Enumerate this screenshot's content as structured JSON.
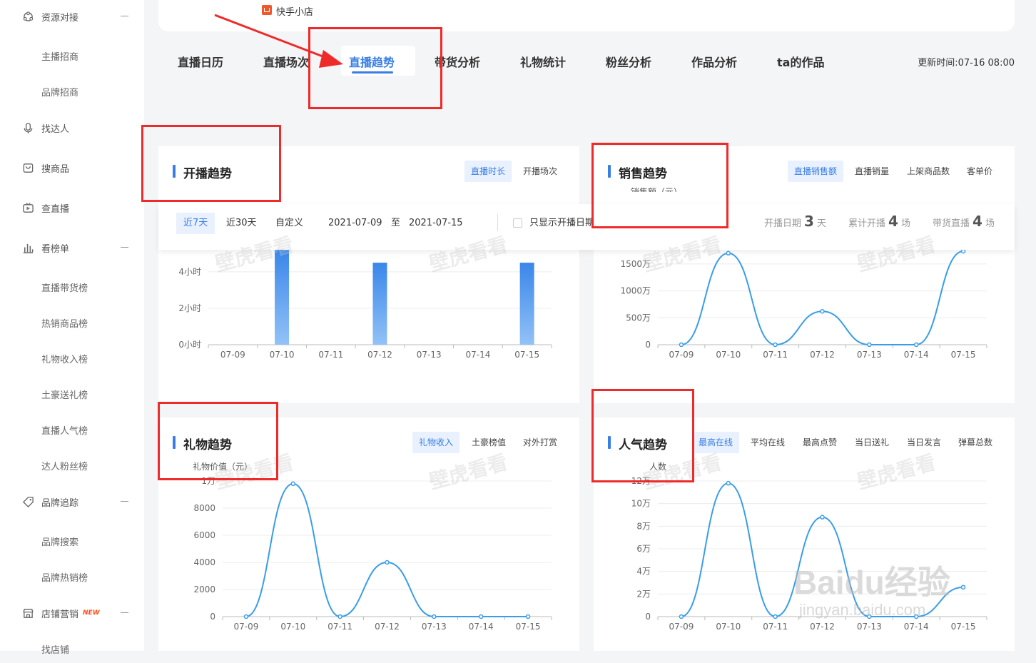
{
  "sidebar": {
    "items": [
      {
        "type": "parent",
        "label": "资源对接",
        "icon": "resource-icon",
        "collapse": true
      },
      {
        "type": "child",
        "label": "主播招商"
      },
      {
        "type": "child",
        "label": "品牌招商"
      },
      {
        "type": "parent",
        "label": "找达人",
        "icon": "microphone-icon"
      },
      {
        "type": "parent",
        "label": "搜商品",
        "icon": "shopping-bag-icon"
      },
      {
        "type": "parent",
        "label": "查直播",
        "icon": "tv-icon"
      },
      {
        "type": "parent",
        "label": "看榜单",
        "icon": "bar-chart-icon",
        "collapse": true
      },
      {
        "type": "child",
        "label": "直播带货榜"
      },
      {
        "type": "child",
        "label": "热销商品榜"
      },
      {
        "type": "child",
        "label": "礼物收入榜"
      },
      {
        "type": "child",
        "label": "土豪送礼榜"
      },
      {
        "type": "child",
        "label": "直播人气榜"
      },
      {
        "type": "child",
        "label": "达人粉丝榜"
      },
      {
        "type": "parent",
        "label": "品牌追踪",
        "icon": "tag-icon",
        "collapse": true
      },
      {
        "type": "child",
        "label": "品牌搜索"
      },
      {
        "type": "child",
        "label": "品牌热销榜"
      },
      {
        "type": "parent",
        "label": "店铺营销",
        "icon": "store-icon",
        "collapse": true,
        "badge": "NEW"
      },
      {
        "type": "child",
        "label": "找店铺"
      }
    ]
  },
  "top": {
    "shop_name": "快手小店"
  },
  "tabs": [
    "直播日历",
    "直播场次",
    "直播趋势",
    "带货分析",
    "礼物统计",
    "粉丝分析",
    "作品分析",
    "ta的作品"
  ],
  "active_tab": "直播趋势",
  "update_time": "更新时间:07-16 08:00",
  "filter": {
    "ranges": [
      "近7天",
      "近30天",
      "自定义"
    ],
    "active_range": "近7天",
    "date_start": "2021-07-09",
    "date_sep": "至",
    "date_end": "2021-07-15",
    "checkbox_label": "只显示开播日期",
    "stats": [
      {
        "label": "开播日期",
        "value": "3",
        "unit": "天"
      },
      {
        "label": "累计开播",
        "value": "4",
        "unit": "场"
      },
      {
        "label": "带货直播",
        "value": "4",
        "unit": "场"
      }
    ]
  },
  "panels": {
    "broadcast": {
      "title": "开播趋势",
      "buttons": [
        "直播时长",
        "开播场次"
      ],
      "active": "直播时长"
    },
    "sales": {
      "title": "销售趋势",
      "buttons": [
        "直播销售额",
        "直播销量",
        "上架商品数",
        "客单价"
      ],
      "active": "直播销售额",
      "unit_partial": "销售额（元）"
    },
    "gift": {
      "title": "礼物趋势",
      "buttons": [
        "礼物收入",
        "土豪榜值",
        "对外打赏"
      ],
      "active": "礼物收入",
      "unit": "礼物价值（元）"
    },
    "popularity": {
      "title": "人气趋势",
      "buttons": [
        "最高在线",
        "平均在线",
        "最高点赞",
        "当日送礼",
        "当日发言",
        "弹幕总数"
      ],
      "active": "最高在线",
      "unit": "人数"
    }
  },
  "chart_data": [
    {
      "type": "bar",
      "name_ref": "开播趋势",
      "categories": [
        "07-09",
        "07-10",
        "07-11",
        "07-12",
        "07-13",
        "07-14",
        "07-15"
      ],
      "values": [
        0,
        6.5,
        0,
        4.5,
        0,
        0,
        4.5
      ],
      "ytick_labels": [
        "0小时",
        "2小时",
        "4小时"
      ],
      "yticks": [
        0,
        2,
        4
      ],
      "ylim": [
        0,
        5.6
      ],
      "ylabel": "",
      "xlabel": ""
    },
    {
      "type": "line",
      "name_ref": "销售趋势",
      "categories": [
        "07-09",
        "07-10",
        "07-11",
        "07-12",
        "07-13",
        "07-14",
        "07-15"
      ],
      "values": [
        0,
        1700,
        0,
        620,
        0,
        0,
        1750
      ],
      "ytick_labels": [
        "0",
        "500万",
        "1000万",
        "1500万"
      ],
      "yticks": [
        0,
        500,
        1000,
        1500
      ],
      "ylim": [
        0,
        1750
      ],
      "unit": "万"
    },
    {
      "type": "line",
      "name_ref": "礼物趋势",
      "categories": [
        "07-09",
        "07-10",
        "07-11",
        "07-12",
        "07-13",
        "07-14",
        "07-15"
      ],
      "values": [
        0,
        9800,
        0,
        4000,
        0,
        0,
        0
      ],
      "ytick_labels": [
        "0",
        "2000",
        "4000",
        "6000",
        "8000",
        "1万"
      ],
      "yticks": [
        0,
        2000,
        4000,
        6000,
        8000,
        10000
      ],
      "ylim": [
        0,
        10000
      ]
    },
    {
      "type": "line",
      "name_ref": "人气趋势",
      "categories": [
        "07-09",
        "07-10",
        "07-11",
        "07-12",
        "07-13",
        "07-14",
        "07-15"
      ],
      "values": [
        0,
        118000,
        0,
        88000,
        0,
        0,
        26000
      ],
      "ytick_labels": [
        "0",
        "2万",
        "4万",
        "6万",
        "8万",
        "10万",
        "12万"
      ],
      "yticks": [
        0,
        20000,
        40000,
        60000,
        80000,
        100000,
        120000
      ],
      "ylim": [
        0,
        120000
      ]
    }
  ],
  "colors": {
    "accent": "#3a7ee5",
    "line": "#3a9de8",
    "highlight_box": "#ee2a2a"
  },
  "watermarks": {
    "text": "壁虎看看",
    "brand": "Baidu经验",
    "url": "jingyan.baidu.com"
  }
}
